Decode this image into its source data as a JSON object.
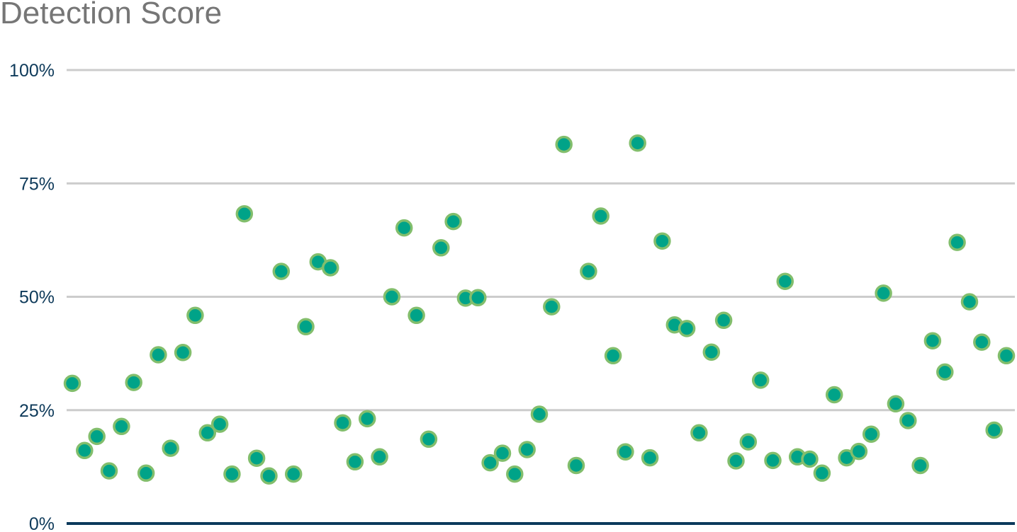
{
  "chart_data": {
    "type": "scatter",
    "title": "Detection Score",
    "xlabel": "",
    "ylabel": "",
    "ylim": [
      0,
      100
    ],
    "y_ticks": [
      0,
      25,
      50,
      75,
      100
    ],
    "y_tick_labels": [
      "0%",
      "25%",
      "50%",
      "75%",
      "100%"
    ],
    "grid": true,
    "legend": "none",
    "colors": {
      "marker_fill": "#00a388",
      "marker_stroke": "#82be6c",
      "grid": "#cccccc",
      "baseline": "#0b3a5c",
      "tick_label": "#0e3a5a",
      "title": "#767676"
    },
    "series": [
      {
        "name": "Detection Score",
        "x": [
          1,
          2,
          3,
          4,
          5,
          6,
          7,
          8,
          9,
          10,
          11,
          12,
          13,
          14,
          15,
          16,
          17,
          18,
          19,
          20,
          21,
          22,
          23,
          24,
          25,
          26,
          27,
          28,
          29,
          30,
          31,
          32,
          33,
          34,
          35,
          36,
          37,
          38,
          39,
          40,
          41,
          42,
          43,
          44,
          45,
          46,
          47,
          48,
          49,
          50,
          51,
          52,
          53,
          54,
          55,
          56,
          57,
          58,
          59,
          60,
          61,
          62,
          63,
          64,
          65,
          66,
          67,
          68,
          69,
          70,
          71,
          72,
          73,
          74,
          75,
          76,
          77
        ],
        "values": [
          30.9,
          16.1,
          19.2,
          11.6,
          21.4,
          31.1,
          11.1,
          37.2,
          16.6,
          37.7,
          45.9,
          20.0,
          21.9,
          10.9,
          68.3,
          14.4,
          10.5,
          55.6,
          10.9,
          43.4,
          57.7,
          56.4,
          22.2,
          13.6,
          23.1,
          14.7,
          50.0,
          65.2,
          45.9,
          18.6,
          60.8,
          66.6,
          49.7,
          49.8,
          13.4,
          15.5,
          10.9,
          16.3,
          24.1,
          47.8,
          83.6,
          12.8,
          55.6,
          67.8,
          37.0,
          15.8,
          83.9,
          14.5,
          62.3,
          43.8,
          43.0,
          20.0,
          37.8,
          44.8,
          13.8,
          18.0,
          31.6,
          13.9,
          53.4,
          14.7,
          14.2,
          11.1,
          28.4,
          14.5,
          15.9,
          19.7,
          50.8,
          26.4,
          22.7,
          12.8,
          40.3,
          33.4,
          62.0,
          48.9,
          40.0,
          20.6,
          37.0
        ]
      }
    ]
  }
}
